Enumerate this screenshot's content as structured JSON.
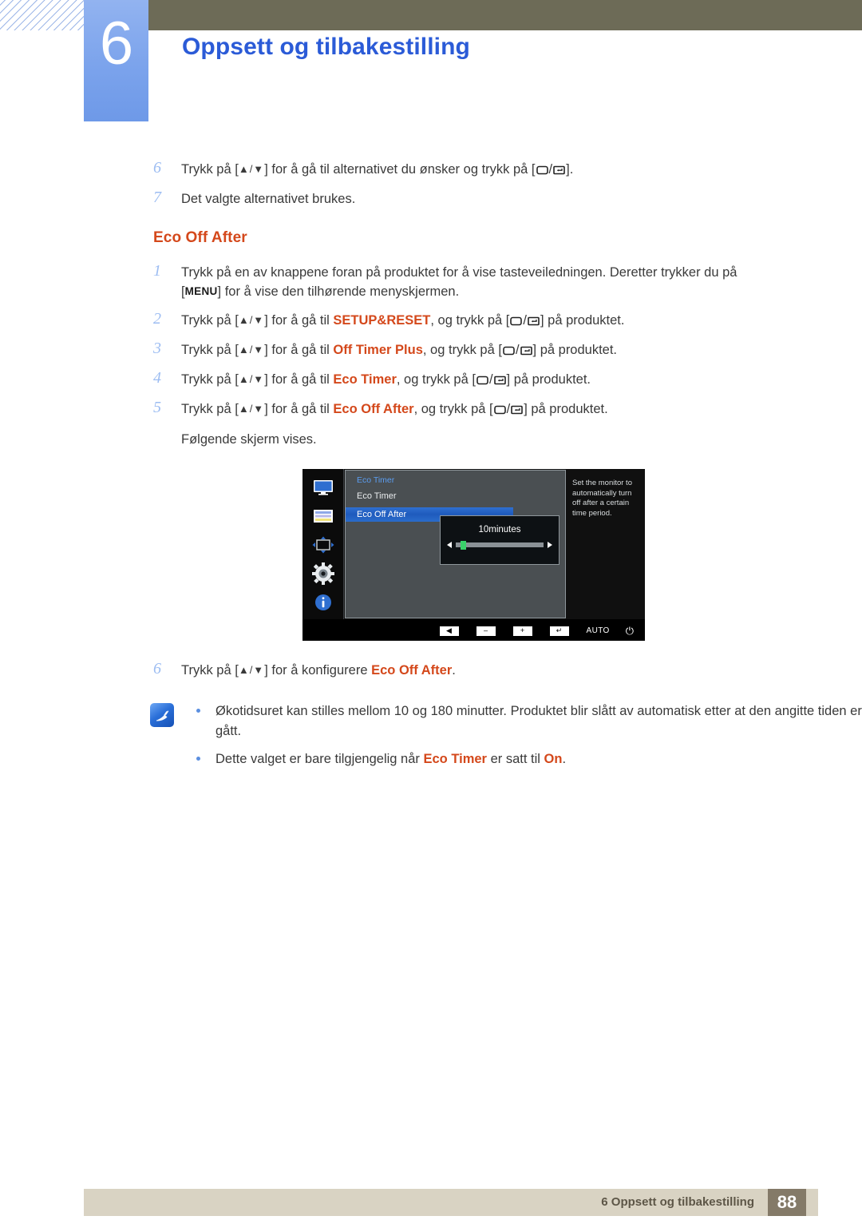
{
  "header": {
    "chapter_number": "6",
    "chapter_title": "Oppsett og tilbakestilling",
    "accent_blue": "#2b5bd7",
    "olive": "#6d6b57",
    "chapter_box_blue": "#7ba3ec"
  },
  "top_steps": [
    {
      "num": "6",
      "parts": [
        {
          "t": "Trykk på [",
          "k": "plain"
        },
        {
          "t": "▲/▼",
          "k": "arrows"
        },
        {
          "t": "] for å gå til alternativet du ønsker og trykk på [",
          "k": "plain"
        },
        {
          "t": "key-pair",
          "k": "keys"
        },
        {
          "t": "].",
          "k": "plain"
        }
      ]
    },
    {
      "num": "7",
      "parts": [
        {
          "t": "Det valgte alternativet brukes.",
          "k": "plain"
        }
      ]
    }
  ],
  "section": {
    "title": "Eco Off After",
    "title_color": "#d4481b"
  },
  "steps": [
    {
      "num": "1",
      "line1_a": "Trykk på en av knappene foran på produktet for å vise tasteveiledningen. Deretter trykker du på",
      "line2_bracket_open": "[",
      "line2_menu": "MENU",
      "line2_rest": "] for å vise den tilhørende menyskjermen."
    },
    {
      "num": "2",
      "pre": "Trykk på [",
      "arrows": "▲/▼",
      "mid": "] for å gå til ",
      "highlight": "SETUP&RESET",
      "mid2": ", og trykk på [",
      "post": "] på produktet."
    },
    {
      "num": "3",
      "pre": "Trykk på [",
      "arrows": "▲/▼",
      "mid": "] for å gå til ",
      "highlight": "Off Timer Plus",
      "mid2": ", og trykk på [",
      "post": "] på produktet."
    },
    {
      "num": "4",
      "pre": "Trykk på [",
      "arrows": "▲/▼",
      "mid": "] for å gå til ",
      "highlight": "Eco Timer",
      "mid2": ", og trykk på [",
      "post": "] på produktet."
    },
    {
      "num": "5",
      "pre": "Trykk på [",
      "arrows": "▲/▼",
      "mid": "] for å gå til ",
      "highlight": "Eco Off After",
      "mid2": ", og trykk på [",
      "post": "] på produktet."
    }
  ],
  "after_step5_note": "Følgende skjerm vises.",
  "step6": {
    "num": "6",
    "pre": "Trykk på [",
    "arrows": "▲/▼",
    "mid": "] for å konfigurere ",
    "highlight": "Eco Off After",
    "post": "."
  },
  "osd": {
    "heading": "Eco Timer",
    "items": [
      {
        "label": "Eco Timer",
        "selected": false
      },
      {
        "label": "Eco Off After",
        "selected": true
      }
    ],
    "slider": {
      "value_label": "10minutes",
      "knob_color": "#3ad16a",
      "track_color": "#8a9196"
    },
    "description": "Set the monitor to automatically turn off after a certain time period.",
    "rail_icons": [
      "monitor-icon",
      "picture-color-icon",
      "size-position-icon",
      "setup-gear-icon",
      "information-icon"
    ],
    "bottom_buttons": [
      {
        "name": "back-button",
        "glyph": "◀"
      },
      {
        "name": "minus-button",
        "glyph": "–"
      },
      {
        "name": "plus-button",
        "glyph": "+"
      },
      {
        "name": "enter-button",
        "glyph": "↵"
      },
      {
        "name": "auto-button",
        "glyph": "AUTO"
      },
      {
        "name": "power-button",
        "glyph": "⏻"
      }
    ],
    "selected_bg": "#2f6fd0",
    "panel_bg": "#4a4f52"
  },
  "note": {
    "icon": "note-pen-icon",
    "items": [
      {
        "pre": "Økotidsuret kan stilles mellom 10 og 180 minutter. Produktet blir slått av automatisk etter at den angitte tiden er gått.",
        "has_highlight": false
      },
      {
        "pre": "Dette valget er bare tilgjengelig når ",
        "highlight": "Eco Timer",
        "mid": " er satt til ",
        "highlight2": "On",
        "post": ".",
        "has_highlight": true
      }
    ]
  },
  "footer": {
    "text": "6 Oppsett og tilbakestilling",
    "page": "88",
    "bar_color": "#d9d3c3",
    "page_box_color": "#847a68"
  }
}
